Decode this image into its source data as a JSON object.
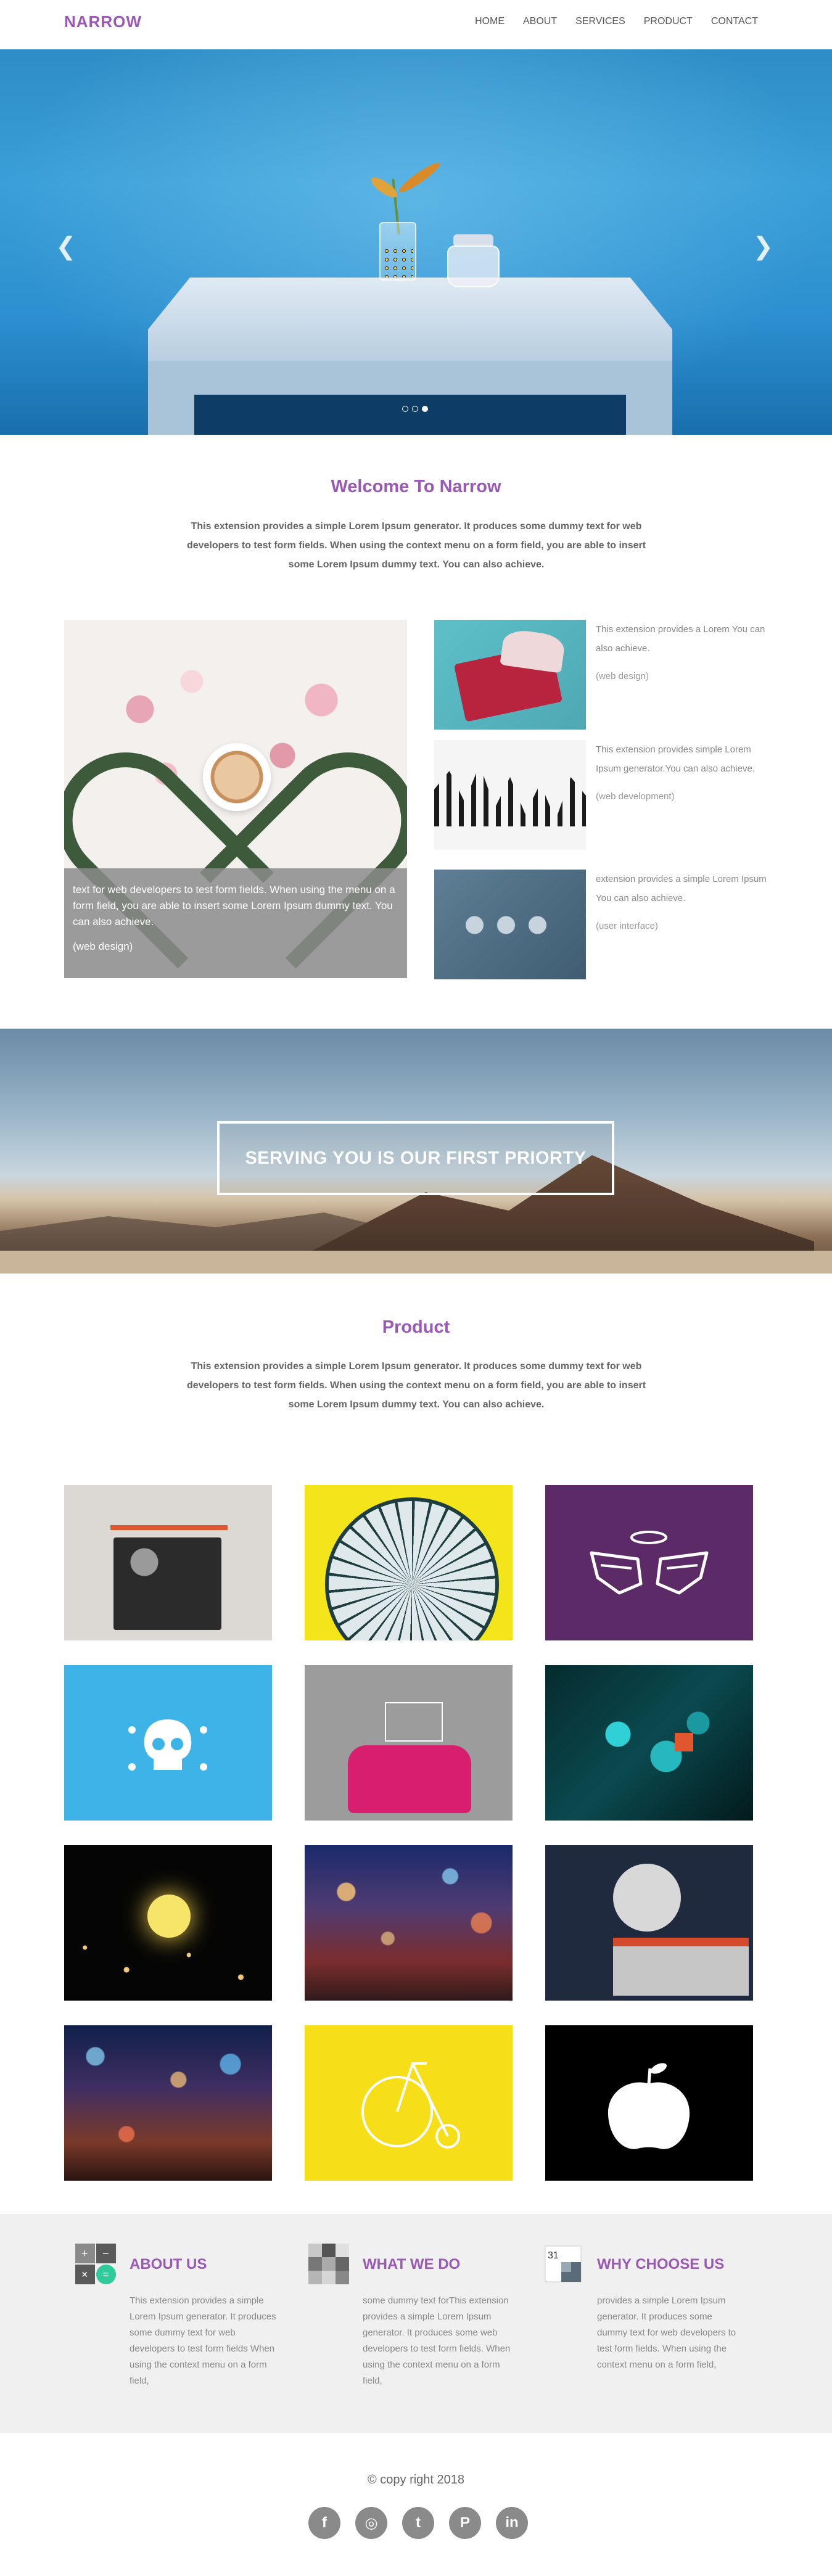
{
  "header": {
    "brand": "NARROW",
    "nav": [
      "HOME",
      "ABOUT",
      "SERVICES",
      "PRODUCT",
      "CONTACT"
    ]
  },
  "hero": {
    "prev_icon": "chevron-left-icon",
    "next_icon": "chevron-right-icon",
    "slide_count": 3,
    "active_slide": 3
  },
  "welcome": {
    "title": "Welcome To Narrow",
    "text": "This extension provides a simple Lorem Ipsum generator. It produces some dummy text for web developers to test form fields. When using the context menu on a form field, you are able to insert some Lorem Ipsum dummy text. You can also achieve."
  },
  "features": {
    "big": {
      "caption": "text for web developers to test form fields. When using the menu on a form field, you are able to insert some Lorem Ipsum dummy text. You can also achieve.",
      "tag": "(web design)"
    },
    "items": [
      {
        "text": "This extension provides a Lorem You can also achieve.",
        "tag": "(web design)"
      },
      {
        "text": "This extension provides simple Lorem Ipsum generator.You can also achieve.",
        "tag": "(web development)"
      },
      {
        "text": "extension provides a simple Lorem Ipsum You can also achieve.",
        "tag": "(user interface)"
      }
    ]
  },
  "banner": {
    "text": "SERVING YOU IS OUR FIRST PRIORTY"
  },
  "product": {
    "title": "Product",
    "text": "This extension provides a simple Lorem Ipsum generator. It produces some dummy text for web developers to test form fields. When using the context menu on a form field, you are able to insert some Lorem Ipsum dummy text. You can also achieve."
  },
  "info": [
    {
      "icon": "calculator-icon",
      "title": "ABOUT US",
      "text": "This extension provides a simple Lorem Ipsum generator. It produces some dummy text for web developers to test form fields When using the context menu on a form field,"
    },
    {
      "icon": "grid-icon",
      "title": "WHAT WE DO",
      "text": "some dummy text forThis extension provides a simple Lorem Ipsum generator. It produces some web developers to test form fields. When using the context menu on a form field,"
    },
    {
      "icon": "calendar-icon",
      "title": "WHY CHOOSE US",
      "text": "provides a simple Lorem Ipsum generator. It produces some dummy text for web developers to test form fields. When using the context menu on a form field,"
    }
  ],
  "footer": {
    "copyright": "© copy right 2018",
    "socials": [
      {
        "icon": "facebook-icon",
        "glyph": "f"
      },
      {
        "icon": "instagram-icon",
        "glyph": "◎"
      },
      {
        "icon": "twitter-icon",
        "glyph": "t"
      },
      {
        "icon": "pinterest-icon",
        "glyph": "P"
      },
      {
        "icon": "linkedin-icon",
        "glyph": "in"
      }
    ]
  }
}
